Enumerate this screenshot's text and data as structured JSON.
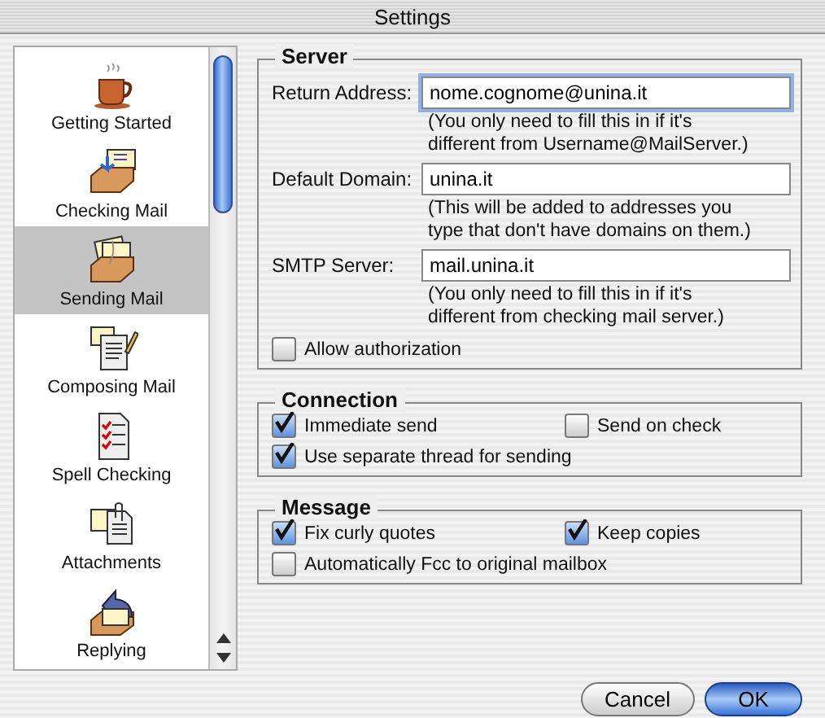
{
  "window": {
    "title": "Settings"
  },
  "sidebar": {
    "items": [
      {
        "label": "Getting Started",
        "selected": false
      },
      {
        "label": "Checking Mail",
        "selected": false
      },
      {
        "label": "Sending Mail",
        "selected": true
      },
      {
        "label": "Composing Mail",
        "selected": false
      },
      {
        "label": "Spell Checking",
        "selected": false
      },
      {
        "label": "Attachments",
        "selected": false
      },
      {
        "label": "Replying",
        "selected": false
      }
    ]
  },
  "server": {
    "title": "Server",
    "fields": [
      {
        "label": "Return Address:",
        "value": "nome.cognome@unina.it",
        "focused": true,
        "note": "(You only need to fill this in if it's\ndifferent from Username@MailServer.)"
      },
      {
        "label": "Default Domain:",
        "value": "unina.it",
        "focused": false,
        "note": "(This will be added to addresses you\ntype that don't have domains on them.)"
      },
      {
        "label": "SMTP Server:",
        "value": "mail.unina.it",
        "focused": false,
        "note": "(You only need to fill this in if it's\ndifferent from checking mail server.)"
      }
    ],
    "options": [
      {
        "label": "Allow authorization",
        "checked": false
      }
    ]
  },
  "connection": {
    "title": "Connection",
    "options": [
      {
        "label": "Immediate send",
        "checked": true
      },
      {
        "label": "Send on check",
        "checked": false
      },
      {
        "label": "Use separate thread for sending",
        "checked": true
      }
    ]
  },
  "message": {
    "title": "Message",
    "options": [
      {
        "label": "Fix curly quotes",
        "checked": true
      },
      {
        "label": "Keep copies",
        "checked": true
      },
      {
        "label": "Automatically Fcc to original mailbox",
        "checked": false
      }
    ]
  },
  "buttons": [
    {
      "label": "Cancel",
      "default": false
    },
    {
      "label": "OK",
      "default": true
    }
  ]
}
